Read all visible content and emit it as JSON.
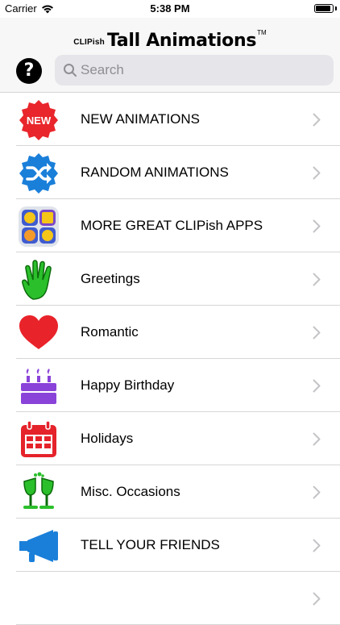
{
  "status": {
    "carrier": "Carrier",
    "time": "5:38 PM",
    "battery_level": 0.9
  },
  "header": {
    "brand_prefix": "CLIPish",
    "title": "Tall Animations",
    "tm": "TM",
    "help_label": "?",
    "search_placeholder": "Search"
  },
  "rows": [
    {
      "label": "NEW ANIMATIONS",
      "icon": "new-badge-icon",
      "color": "#e8262b"
    },
    {
      "label": "RANDOM ANIMATIONS",
      "icon": "shuffle-badge-icon",
      "color": "#1a7fd9"
    },
    {
      "label": "MORE GREAT CLIPish APPS",
      "icon": "apps-grid-icon",
      "color": "#5b6ed0"
    },
    {
      "label": "Greetings",
      "icon": "waving-hand-icon",
      "color": "#2bbf2b"
    },
    {
      "label": "Romantic",
      "icon": "heart-icon",
      "color": "#e9232a"
    },
    {
      "label": "Happy Birthday",
      "icon": "birthday-cake-icon",
      "color": "#8a43d9"
    },
    {
      "label": "Holidays",
      "icon": "calendar-icon",
      "color": "#e5232b"
    },
    {
      "label": "Misc. Occasions",
      "icon": "champagne-toast-icon",
      "color": "#2bbf2b"
    },
    {
      "label": "TELL YOUR FRIENDS",
      "icon": "megaphone-icon",
      "color": "#1a7fd9"
    },
    {
      "label": "",
      "icon": "",
      "color": ""
    }
  ]
}
